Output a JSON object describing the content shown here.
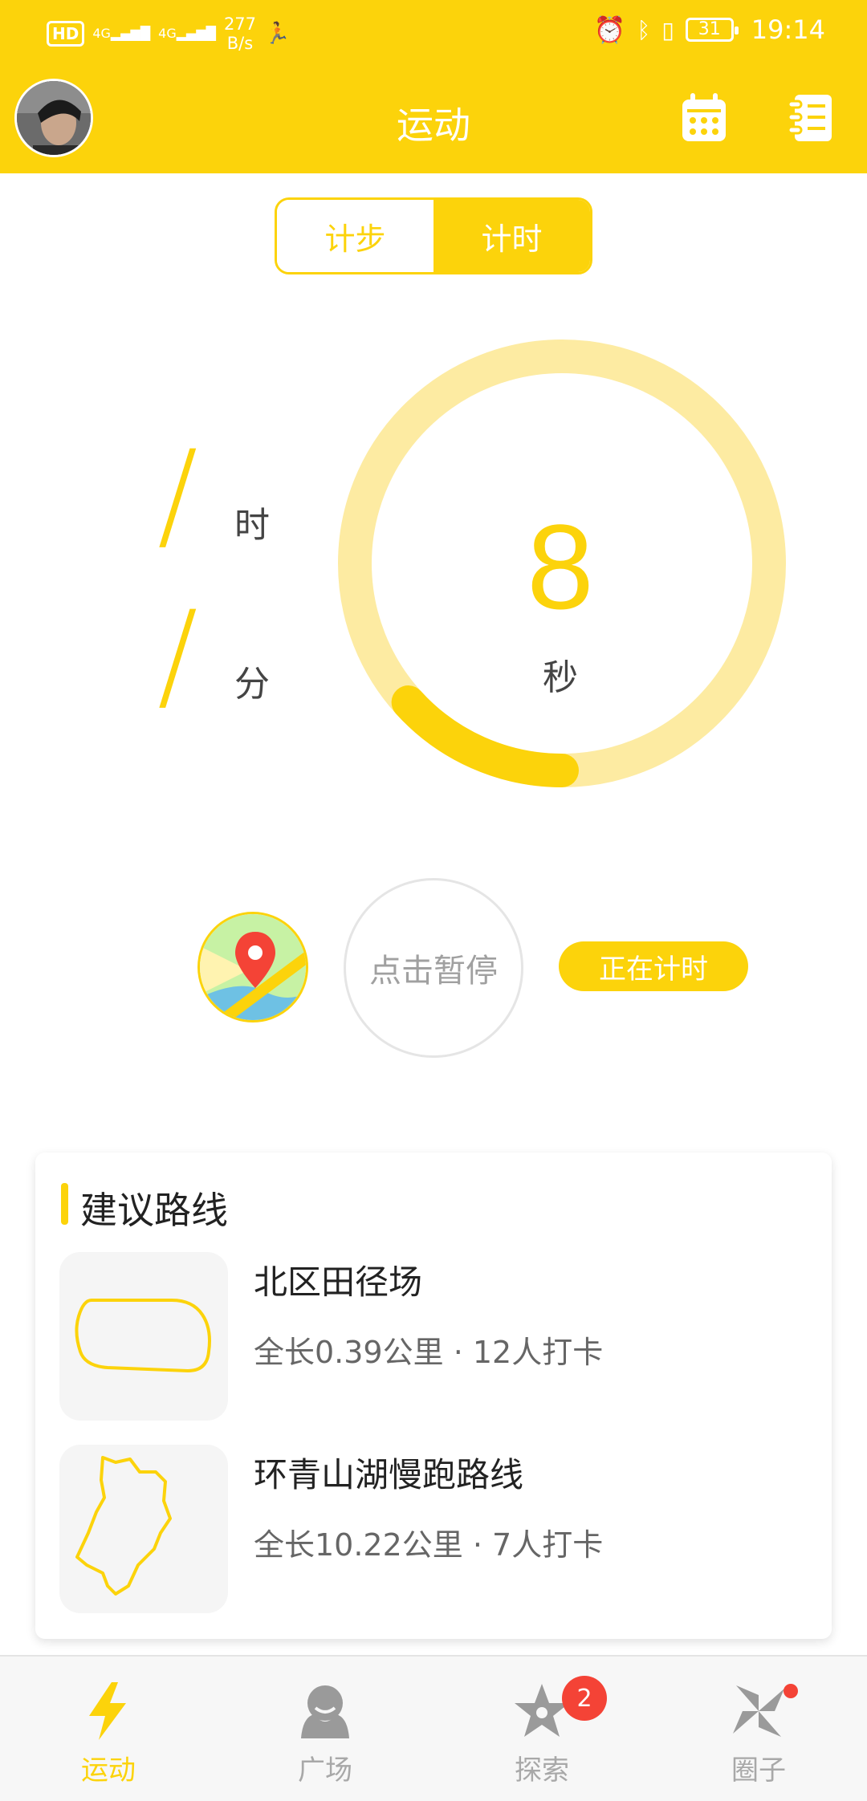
{
  "status_bar": {
    "hd": "HD",
    "net1": "4G",
    "net2": "4G",
    "speed_value": "277",
    "speed_unit": "B/s",
    "battery": "31",
    "time": "19:14"
  },
  "header": {
    "title": "运动",
    "calendar_icon": "calendar-icon",
    "notebook_icon": "notebook-icon"
  },
  "mode_tabs": [
    {
      "label": "计步",
      "selected": false
    },
    {
      "label": "计时",
      "selected": true
    }
  ],
  "timer": {
    "hours_placeholder": "/",
    "hours_unit": "时",
    "minutes_placeholder": "/",
    "minutes_unit": "分",
    "seconds_value": "8",
    "seconds_unit": "秒",
    "progress_fraction": 0.133
  },
  "actions": {
    "pause_label": "点击暂停",
    "status_label": "正在计时",
    "map_icon": "map-pin-icon"
  },
  "routes": {
    "title": "建议路线",
    "items": [
      {
        "name": "北区田径场",
        "meta": "全长0.39公里 · 12人打卡"
      },
      {
        "name": "环青山湖慢跑路线",
        "meta": "全长10.22公里 · 7人打卡"
      }
    ]
  },
  "nav": {
    "items": [
      {
        "label": "运动",
        "icon": "lightning-icon",
        "active": true
      },
      {
        "label": "广场",
        "icon": "plaza-icon",
        "active": false
      },
      {
        "label": "探索",
        "icon": "star-icon",
        "active": false,
        "badge": "2"
      },
      {
        "label": "圈子",
        "icon": "pinwheel-icon",
        "active": false,
        "dot": true
      }
    ]
  },
  "colors": {
    "accent": "#FCD30B",
    "accent_light": "#FDEBA2",
    "badge": "#F44336"
  }
}
